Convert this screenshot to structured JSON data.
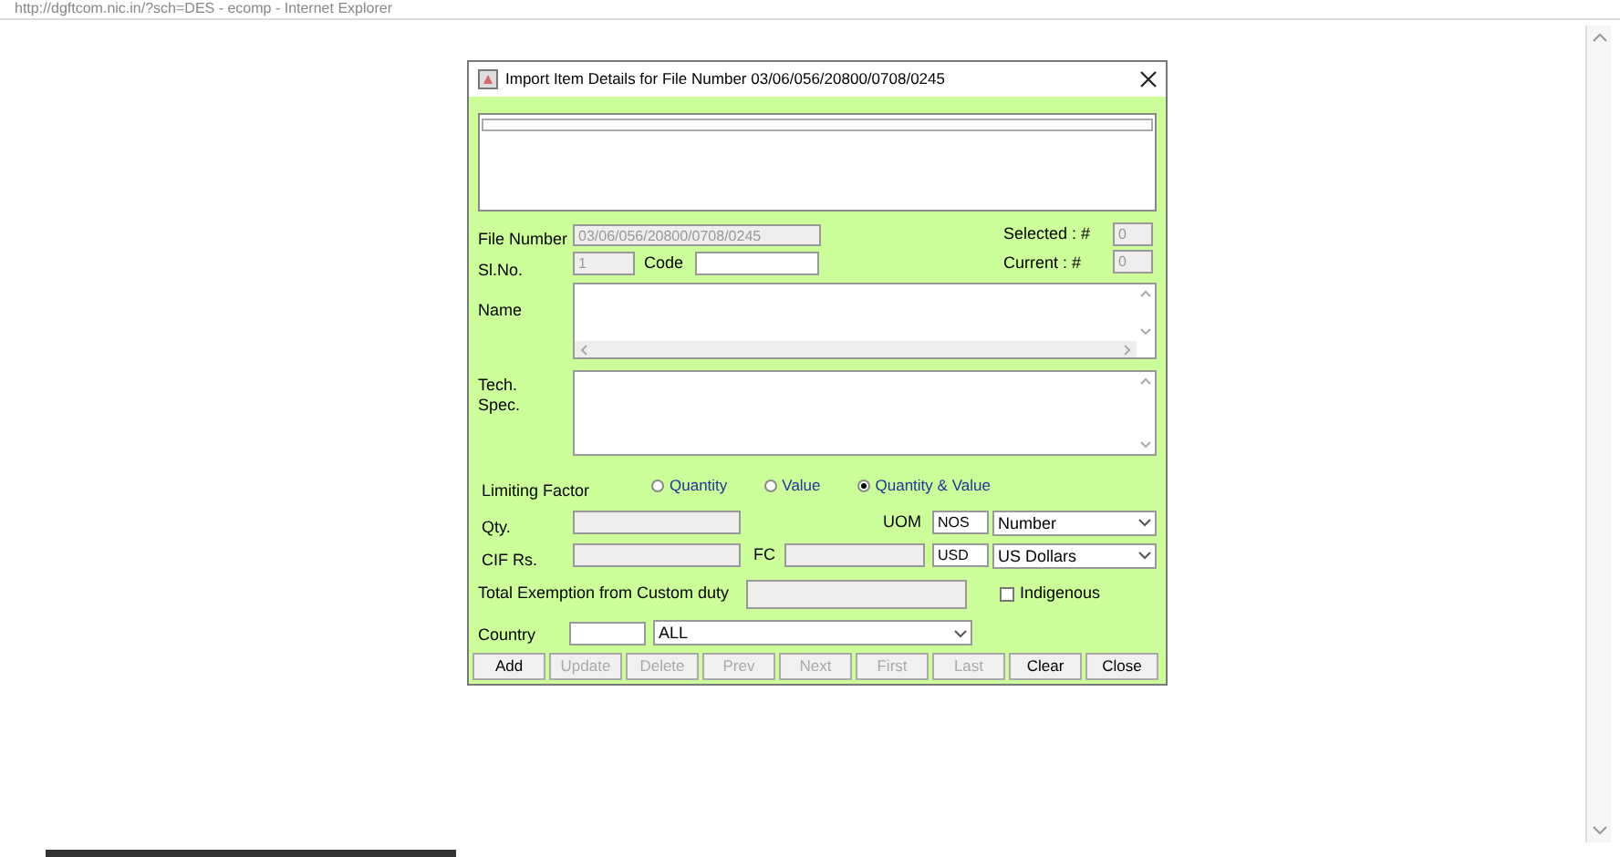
{
  "browser": {
    "title": "http://dgftcom.nic.in/?sch=DES - ecomp - Internet Explorer"
  },
  "dialog": {
    "title": "Import Item Details for File Number 03/06/056/20800/0708/0245",
    "file_number": {
      "label": "File Number",
      "value": "03/06/056/20800/0708/0245"
    },
    "sl_no": {
      "label": "Sl.No.",
      "value": "1"
    },
    "code": {
      "label": "Code"
    },
    "selected": {
      "label": "Selected : #",
      "value": "0"
    },
    "current": {
      "label": "Current : #",
      "value": "0"
    },
    "name": {
      "label": "Name"
    },
    "tech_spec": {
      "label": "Tech. Spec."
    },
    "limiting_factor": {
      "label": "Limiting Factor",
      "options": [
        {
          "label": "Quantity",
          "selected": false
        },
        {
          "label": "Value",
          "selected": false
        },
        {
          "label": "Quantity & Value",
          "selected": true
        }
      ]
    },
    "qty": {
      "label": "Qty."
    },
    "uom": {
      "label": "UOM",
      "code": "NOS",
      "select": "Number"
    },
    "cif": {
      "label": "CIF Rs."
    },
    "fc": {
      "label": "FC",
      "code": "USD",
      "select": "US Dollars"
    },
    "total_exemption": {
      "label": "Total Exemption from Custom duty"
    },
    "indigenous": {
      "label": "Indigenous",
      "checked": false
    },
    "country": {
      "label": "Country",
      "select": "ALL"
    },
    "buttons": [
      {
        "label": "Add",
        "disabled": false
      },
      {
        "label": "Update",
        "disabled": true
      },
      {
        "label": "Delete",
        "disabled": true
      },
      {
        "label": "Prev",
        "disabled": true
      },
      {
        "label": "Next",
        "disabled": true
      },
      {
        "label": "First",
        "disabled": true
      },
      {
        "label": "Last",
        "disabled": true
      },
      {
        "label": "Clear",
        "disabled": false
      },
      {
        "label": "Close",
        "disabled": false
      }
    ]
  }
}
